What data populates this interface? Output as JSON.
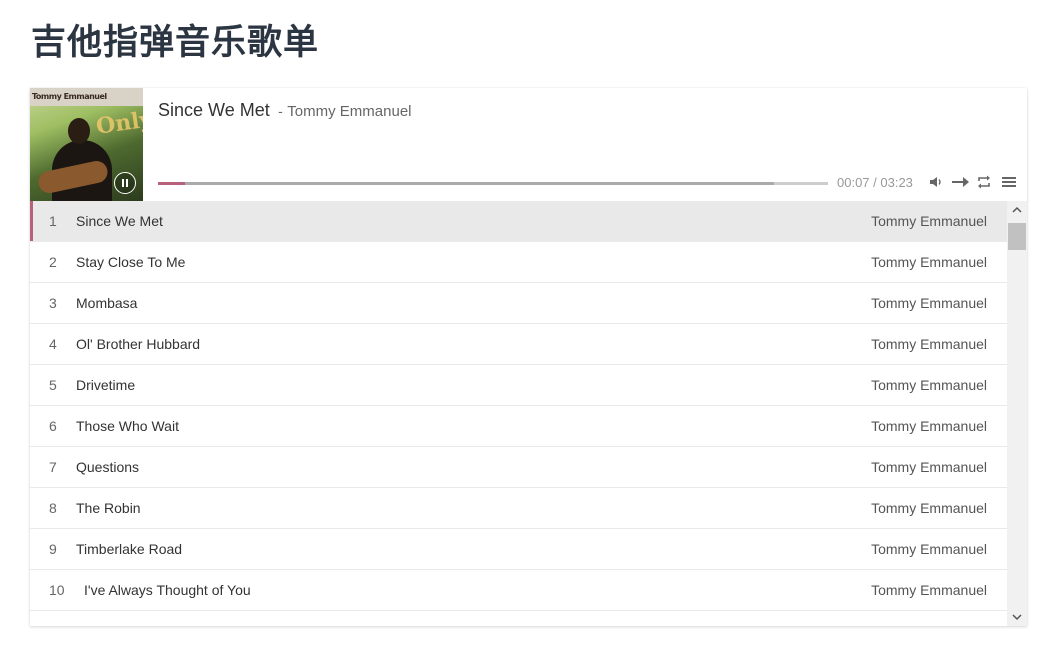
{
  "page": {
    "title": "吉他指弹音乐歌单"
  },
  "cover": {
    "artist_text": "Tommy Emmanuel",
    "album_text": "Only"
  },
  "now_playing": {
    "title": "Since We Met",
    "separator": "-",
    "artist": "Tommy Emmanuel",
    "time": "00:07 / 03:23",
    "played_fraction": 0.04,
    "loaded_fraction": 0.92
  },
  "controls": {
    "pause": "pause-icon",
    "volume": "volume-icon",
    "order": "order-arrow-icon",
    "loop": "loop-icon",
    "menu": "menu-icon"
  },
  "colors": {
    "accent": "#b7627a",
    "title": "#2c3542"
  },
  "playlist": [
    {
      "index": "1",
      "name": "Since We Met",
      "artist": "Tommy Emmanuel"
    },
    {
      "index": "2",
      "name": "Stay Close To Me",
      "artist": "Tommy Emmanuel"
    },
    {
      "index": "3",
      "name": "Mombasa",
      "artist": "Tommy Emmanuel"
    },
    {
      "index": "4",
      "name": "Ol' Brother Hubbard",
      "artist": "Tommy Emmanuel"
    },
    {
      "index": "5",
      "name": "Drivetime",
      "artist": "Tommy Emmanuel"
    },
    {
      "index": "6",
      "name": "Those Who Wait",
      "artist": "Tommy Emmanuel"
    },
    {
      "index": "7",
      "name": "Questions",
      "artist": "Tommy Emmanuel"
    },
    {
      "index": "8",
      "name": "The Robin",
      "artist": "Tommy Emmanuel"
    },
    {
      "index": "9",
      "name": "Timberlake Road",
      "artist": "Tommy Emmanuel"
    },
    {
      "index": "10",
      "name": "I've Always Thought of You",
      "artist": "Tommy Emmanuel"
    }
  ]
}
